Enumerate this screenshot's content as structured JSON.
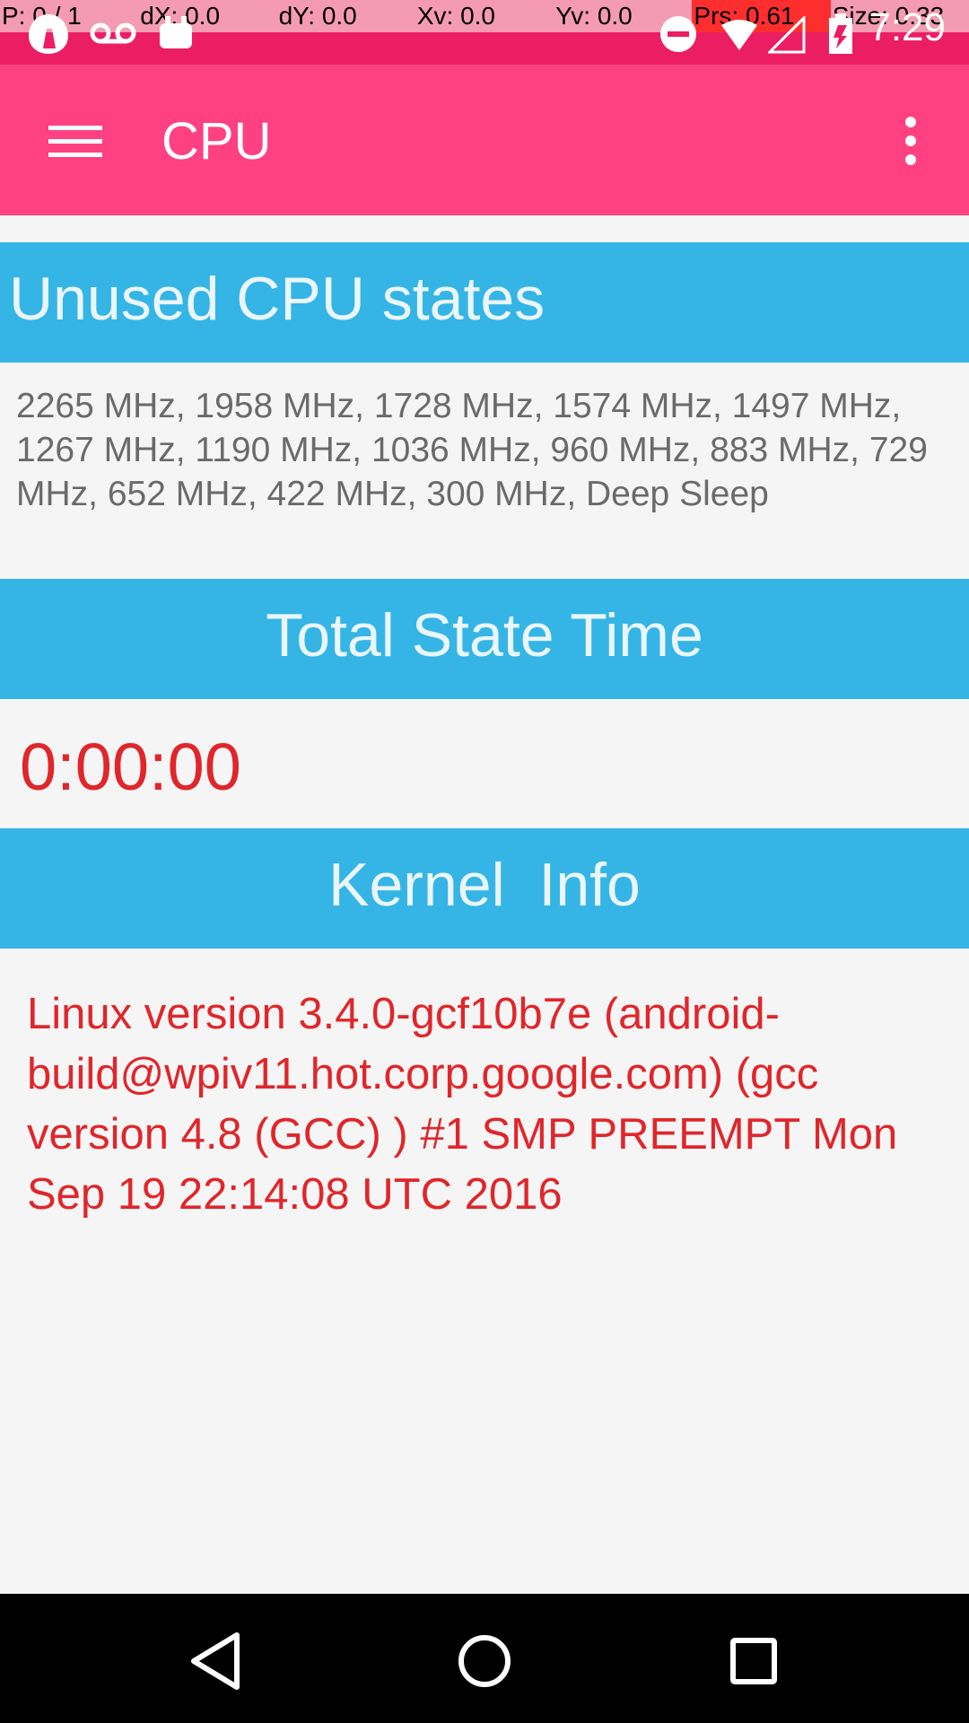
{
  "debug_overlay": {
    "pointer": "P: 0 / 1",
    "dx": "dX: 0.0",
    "dy": "dY: 0.0",
    "xv": "Xv: 0.0",
    "yv": "Yv: 0.0",
    "prs": "Prs: 0.61",
    "size": "Size: 0.33"
  },
  "status_bar": {
    "time": "7:29",
    "icons": [
      "app-notification-icon",
      "voicemail-icon",
      "android-icon",
      "do-not-disturb-icon",
      "wifi-icon",
      "signal-icon",
      "battery-icon"
    ]
  },
  "app_bar": {
    "title": "CPU",
    "menu_icon": "hamburger-menu-icon",
    "overflow_icon": "more-vert-icon"
  },
  "sections": {
    "unused_states": {
      "title": "Unused CPU states",
      "content": "2265 MHz, 1958 MHz, 1728 MHz, 1574 MHz, 1497 MHz, 1267 MHz, 1190 MHz, 1036 MHz, 960 MHz, 883 MHz, 729 MHz, 652 MHz, 422 MHz, 300 MHz, Deep Sleep"
    },
    "total_state_time": {
      "title": "Total State Time",
      "value": "0:00:00"
    },
    "kernel_info": {
      "title": "Kernel  Info",
      "content": "Linux version 3.4.0-gcf10b7e (android-build@wpiv11.hot.corp.google.com) (gcc version 4.8 (GCC) ) #1 SMP PREEMPT Mon Sep 19 22:14:08 UTC 2016"
    }
  },
  "nav_bar": {
    "back_icon": "back-icon",
    "home_icon": "home-icon",
    "recents_icon": "recents-icon"
  },
  "colors": {
    "status_bar": "#ec1e63",
    "app_bar": "#ff4081",
    "section_header": "#35b5e5",
    "accent_text": "#e0262b",
    "background": "#f5f5f5"
  }
}
